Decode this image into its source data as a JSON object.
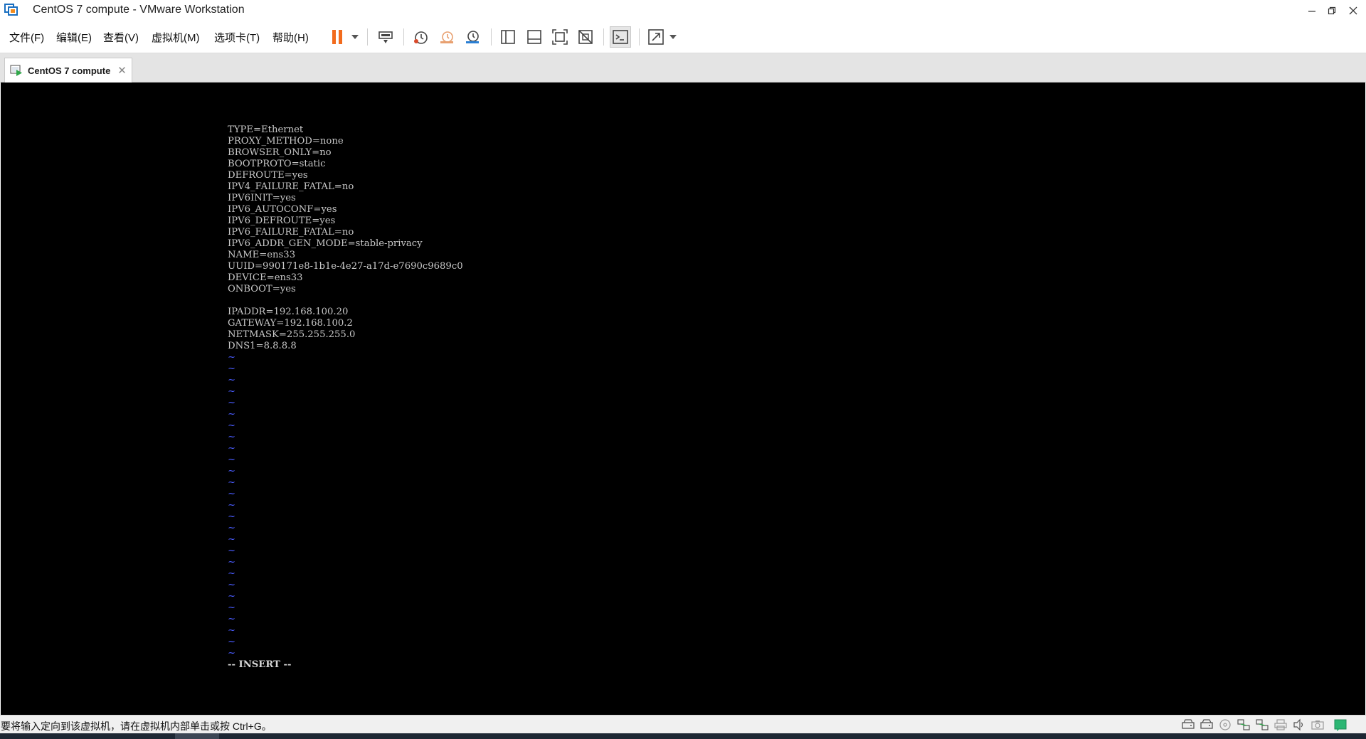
{
  "window": {
    "title": "CentOS 7 compute - VMware Workstation",
    "controls": [
      "minimize-icon",
      "restore-icon",
      "close-icon"
    ]
  },
  "menu": {
    "items": [
      "文件(F)",
      "编辑(E)",
      "查看(V)",
      "虚拟机(M)",
      "选项卡(T)",
      "帮助(H)"
    ]
  },
  "toolbar": {
    "icons": [
      "pause-icon",
      "send-keys-icon",
      "snapshot-icon",
      "revert-snapshot-icon",
      "snapshot-manager-icon",
      "show-library-icon",
      "show-thumbnails-icon",
      "full-screen-icon",
      "unity-icon",
      "console-view-icon",
      "stretch-icon"
    ],
    "pause_color": "#f26b1d"
  },
  "tab": {
    "label": "CentOS 7 compute",
    "close": "✕"
  },
  "console": {
    "lines": [
      "TYPE=Ethernet",
      "PROXY_METHOD=none",
      "BROWSER_ONLY=no",
      "BOOTPROTO=static",
      "DEFROUTE=yes",
      "IPV4_FAILURE_FATAL=no",
      "IPV6INIT=yes",
      "IPV6_AUTOCONF=yes",
      "IPV6_DEFROUTE=yes",
      "IPV6_FAILURE_FATAL=no",
      "IPV6_ADDR_GEN_MODE=stable-privacy",
      "NAME=ens33",
      "UUID=990171e8-1b1e-4e27-a17d-e7690c9689c0",
      "DEVICE=ens33",
      "ONBOOT=yes",
      "",
      "IPADDR=192.168.100.20",
      "GATEWAY=192.168.100.2",
      "NETMASK=255.255.255.0",
      "DNS1=8.8.8.8"
    ],
    "tilde": "~",
    "tilde_count": 27,
    "mode": "-- INSERT --",
    "text_color": "#c8c8c8",
    "tilde_color": "#4a5cff"
  },
  "status": {
    "text": "要将输入定向到该虚拟机，请在虚拟机内部单击或按 Ctrl+G。",
    "icons": [
      "hard-disk-icon",
      "hard-disk-2-icon",
      "cd-rom-icon",
      "network-icon",
      "network-2-icon",
      "printer-icon",
      "sound-icon",
      "camera-icon",
      "message-icon"
    ]
  }
}
